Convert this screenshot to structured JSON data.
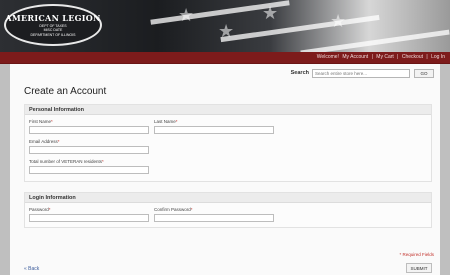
{
  "logo": {
    "name": "AMERICAN LEGION",
    "line2": "DEPT OF TAXES",
    "line3": "MISC DATE",
    "line4": "DEPARTMENT OF ILLINOIS"
  },
  "header": {
    "welcome": "Welcome!",
    "my_account": "My Account",
    "my_cart": "My Cart",
    "checkout": "Checkout",
    "login": "Log In",
    "separator": "|"
  },
  "search": {
    "label": "Search",
    "placeholder": "Search entire store here...",
    "button": "GO"
  },
  "page_title": "Create an Account",
  "personal": {
    "heading": "Personal Information",
    "first_name": "First Name",
    "last_name": "Last Name",
    "email": "Email Address",
    "veteran_residents": "Total number of VETERAN residents",
    "required_mark": "*"
  },
  "login_info": {
    "heading": "Login Information",
    "password": "Password",
    "confirm_password": "Confirm Password",
    "required_mark": "*"
  },
  "footer": {
    "required_note": "* Required Fields",
    "back": "« Back",
    "submit": "SUBMIT"
  }
}
